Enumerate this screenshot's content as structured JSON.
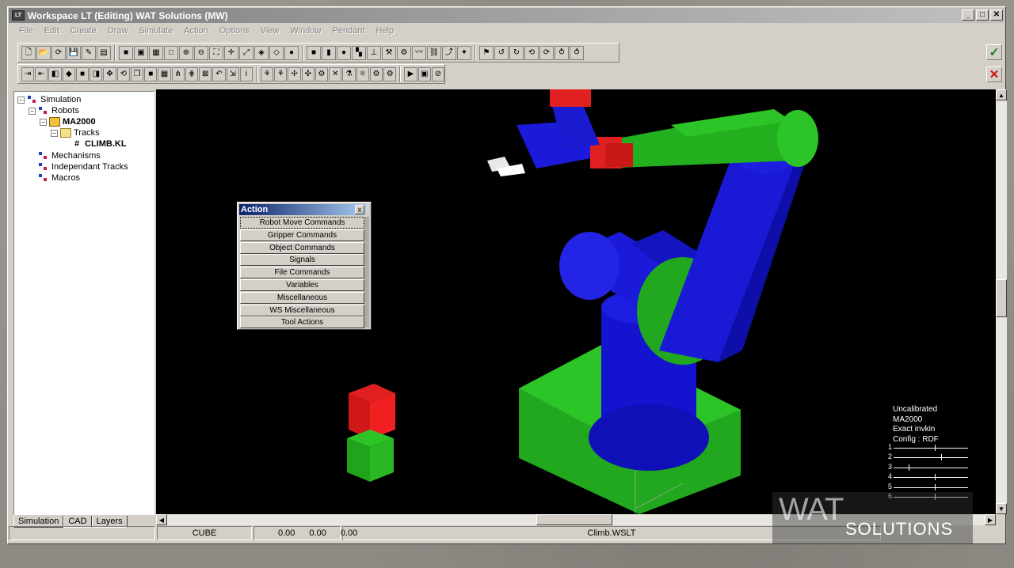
{
  "window": {
    "title": "Workspace LT  (Editing) WAT Solutions (MW)",
    "controls": {
      "minimize": "_",
      "maximize": "□",
      "close": "✕"
    }
  },
  "menu": [
    "File",
    "Edit",
    "Create",
    "Draw",
    "Simulate",
    "Action",
    "Options",
    "View",
    "Window",
    "Pendant",
    "Help"
  ],
  "toolbar1": [
    {
      "name": "new-icon",
      "glyph": "🗋"
    },
    {
      "name": "open-icon",
      "glyph": "📂"
    },
    {
      "name": "refresh-icon",
      "glyph": "⟳"
    },
    {
      "name": "save-icon",
      "glyph": "💾"
    },
    {
      "name": "edit-icon",
      "glyph": "✎"
    },
    {
      "name": "stack-icon",
      "glyph": "▤"
    },
    {
      "name": "sep"
    },
    {
      "name": "cube-blue-icon",
      "glyph": "■"
    },
    {
      "name": "cube-yellow-icon",
      "glyph": "▣"
    },
    {
      "name": "cube-multi-icon",
      "glyph": "▦"
    },
    {
      "name": "cube-outline-icon",
      "glyph": "□"
    },
    {
      "name": "zoom-in-icon",
      "glyph": "⊕"
    },
    {
      "name": "zoom-out-icon",
      "glyph": "⊖"
    },
    {
      "name": "zoom-fit-icon",
      "glyph": "⛶"
    },
    {
      "name": "move-icon",
      "glyph": "✛"
    },
    {
      "name": "pan-icon",
      "glyph": "⤢"
    },
    {
      "name": "rotate-cube-icon",
      "glyph": "◈"
    },
    {
      "name": "wire-cube-icon",
      "glyph": "◇"
    },
    {
      "name": "solid-sphere-icon",
      "glyph": "●"
    },
    {
      "name": "sep"
    },
    {
      "name": "green-cube-icon",
      "glyph": "■"
    },
    {
      "name": "green-cylinder-icon",
      "glyph": "▮"
    },
    {
      "name": "green-sphere-icon",
      "glyph": "●"
    },
    {
      "name": "frame-icon",
      "glyph": "▚"
    },
    {
      "name": "axis-icon",
      "glyph": "⊥"
    },
    {
      "name": "tool-icon",
      "glyph": "⚒"
    },
    {
      "name": "gripper-icon",
      "glyph": "⚙"
    },
    {
      "name": "path-icon",
      "glyph": "〰"
    },
    {
      "name": "link-icon",
      "glyph": "⛓"
    },
    {
      "name": "robot-arm-icon",
      "glyph": "⤴"
    },
    {
      "name": "joint-icon",
      "glyph": "✦"
    },
    {
      "name": "sep"
    },
    {
      "name": "teach-icon",
      "glyph": "⚑"
    },
    {
      "name": "rotate-left-icon",
      "glyph": "↺"
    },
    {
      "name": "rotate-cw-icon",
      "glyph": "↻"
    },
    {
      "name": "rotate-xy-icon",
      "glyph": "⟲"
    },
    {
      "name": "rotate-z-icon",
      "glyph": "⟳"
    },
    {
      "name": "rotate-step-icon",
      "glyph": "⥁"
    },
    {
      "name": "rotate-end-icon",
      "glyph": "⥀"
    }
  ],
  "toolbar2": [
    {
      "name": "pick-icon",
      "glyph": "⇥"
    },
    {
      "name": "place-icon",
      "glyph": "⇤"
    },
    {
      "name": "red-tool-icon",
      "glyph": "◧"
    },
    {
      "name": "red-part-icon",
      "glyph": "◆"
    },
    {
      "name": "red-cube-icon",
      "glyph": "■"
    },
    {
      "name": "gripper-red-icon",
      "glyph": "◨"
    },
    {
      "name": "translate-icon",
      "glyph": "✥"
    },
    {
      "name": "cycle-icon",
      "glyph": "⟲"
    },
    {
      "name": "layers-icon",
      "glyph": "❐"
    },
    {
      "name": "blue-cube-icon",
      "glyph": "■"
    },
    {
      "name": "palette-icon",
      "glyph": "▦"
    },
    {
      "name": "grip-open-icon",
      "glyph": "⋔"
    },
    {
      "name": "grip-close-icon",
      "glyph": "⋕"
    },
    {
      "name": "ruler-icon",
      "glyph": "⊠"
    },
    {
      "name": "undo-icon",
      "glyph": "↶"
    },
    {
      "name": "pointer-icon",
      "glyph": "⇲"
    },
    {
      "name": "info-icon",
      "glyph": "i"
    },
    {
      "name": "sep"
    },
    {
      "name": "robot-a-icon",
      "glyph": "⚘"
    },
    {
      "name": "robot-b-icon",
      "glyph": "⚘"
    },
    {
      "name": "robot-c-icon",
      "glyph": "✢"
    },
    {
      "name": "robot-d-icon",
      "glyph": "✣"
    },
    {
      "name": "robot-e-icon",
      "glyph": "⚙"
    },
    {
      "name": "robot-f-icon",
      "glyph": "✕"
    },
    {
      "name": "robot-g-icon",
      "glyph": "⚗"
    },
    {
      "name": "robot-h-icon",
      "glyph": "⚛"
    },
    {
      "name": "robot-i-icon",
      "glyph": "⚙"
    },
    {
      "name": "robot-j-icon",
      "glyph": "⚙"
    },
    {
      "name": "sep"
    },
    {
      "name": "play-icon",
      "glyph": "▶"
    },
    {
      "name": "record-icon",
      "glyph": "▣"
    },
    {
      "name": "stop-icon",
      "glyph": "⊘"
    }
  ],
  "tree": {
    "root": "Simulation",
    "robots": "Robots",
    "robot": "MA2000",
    "tracks": "Tracks",
    "file": "CLIMB.KL",
    "mechanisms": "Mechanisms",
    "independant": "Independant Tracks",
    "macros": "Macros"
  },
  "tabs": [
    "Simulation",
    "CAD",
    "Layers"
  ],
  "action_panel": {
    "title": "Action",
    "close": "x",
    "items": [
      "Robot Move Commands",
      "Gripper Commands",
      "Object Commands",
      "Signals",
      "File Commands",
      "Variables",
      "Miscellaneous",
      "WS Miscellaneous",
      "Tool Actions"
    ]
  },
  "robot_info": {
    "lines": [
      "Uncalibrated",
      "MA2000",
      "Exact invkin",
      "Config : RDF"
    ],
    "joints": [
      {
        "label": "1",
        "value": 0.55
      },
      {
        "label": "2",
        "value": 0.64
      },
      {
        "label": "3",
        "value": 0.2
      },
      {
        "label": "4",
        "value": 0.55
      },
      {
        "label": "5",
        "value": 0.55
      },
      {
        "label": "6",
        "value": 0.55
      }
    ]
  },
  "status": {
    "object": "CUBE",
    "x": "0.00",
    "y": "0.00",
    "z": "0.00",
    "file": "Climb.WSLT"
  },
  "confirm": {
    "ok": "✓",
    "cancel": "✕"
  },
  "watermark": {
    "top": "WAT",
    "bottom": "SOLUTIONS"
  }
}
